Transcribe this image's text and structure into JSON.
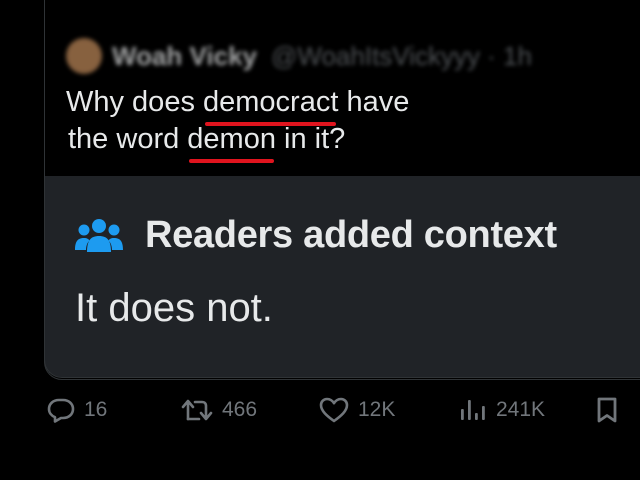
{
  "tweet": {
    "author_name": "Woah Vicky",
    "author_handle": "@WoahItsVickyyy · 1h",
    "text_line1_prefix": "Why does ",
    "text_line1_word": "democract",
    "text_line1_suffix": " have",
    "text_line2_prefix": "the word ",
    "text_line2_word": "demon",
    "text_line2_suffix": " in it?"
  },
  "context": {
    "icon": "people-group-icon",
    "title": "Readers added context",
    "body": "It does not."
  },
  "actions": {
    "replies": "16",
    "reposts": "466",
    "likes": "12K",
    "views": "241K"
  },
  "colors": {
    "background": "#000000",
    "card_border": "#2f3336",
    "context_bg": "#202327",
    "text": "#e7e9ea",
    "muted": "#71767b",
    "icon_blue": "#1d9bf0",
    "underline_red": "#e0141e"
  }
}
